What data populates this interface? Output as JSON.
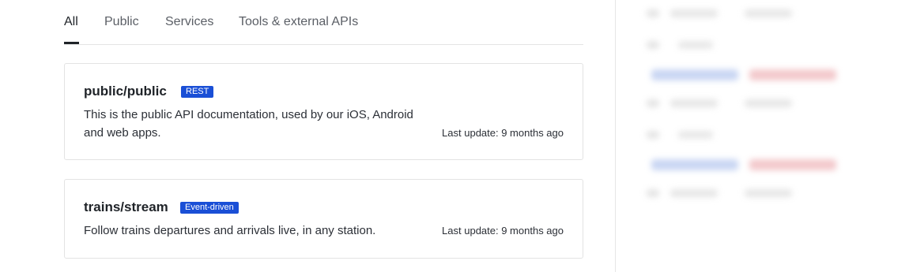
{
  "tabs": [
    {
      "label": "All",
      "active": true
    },
    {
      "label": "Public",
      "active": false
    },
    {
      "label": "Services",
      "active": false
    },
    {
      "label": "Tools & external APIs",
      "active": false
    }
  ],
  "apis": [
    {
      "title": "public/public",
      "badge": "REST",
      "description": "This is the public API documentation, used by our iOS, Android and web apps.",
      "last_update": "Last update: 9 months ago"
    },
    {
      "title": "trains/stream",
      "badge": "Event-driven",
      "description": "Follow trains departures and arrivals live, in any station.",
      "last_update": "Last update: 9 months ago"
    }
  ],
  "colors": {
    "accent": "#1a4fd6",
    "text": "#1f2328",
    "border": "#e3e3e3"
  }
}
